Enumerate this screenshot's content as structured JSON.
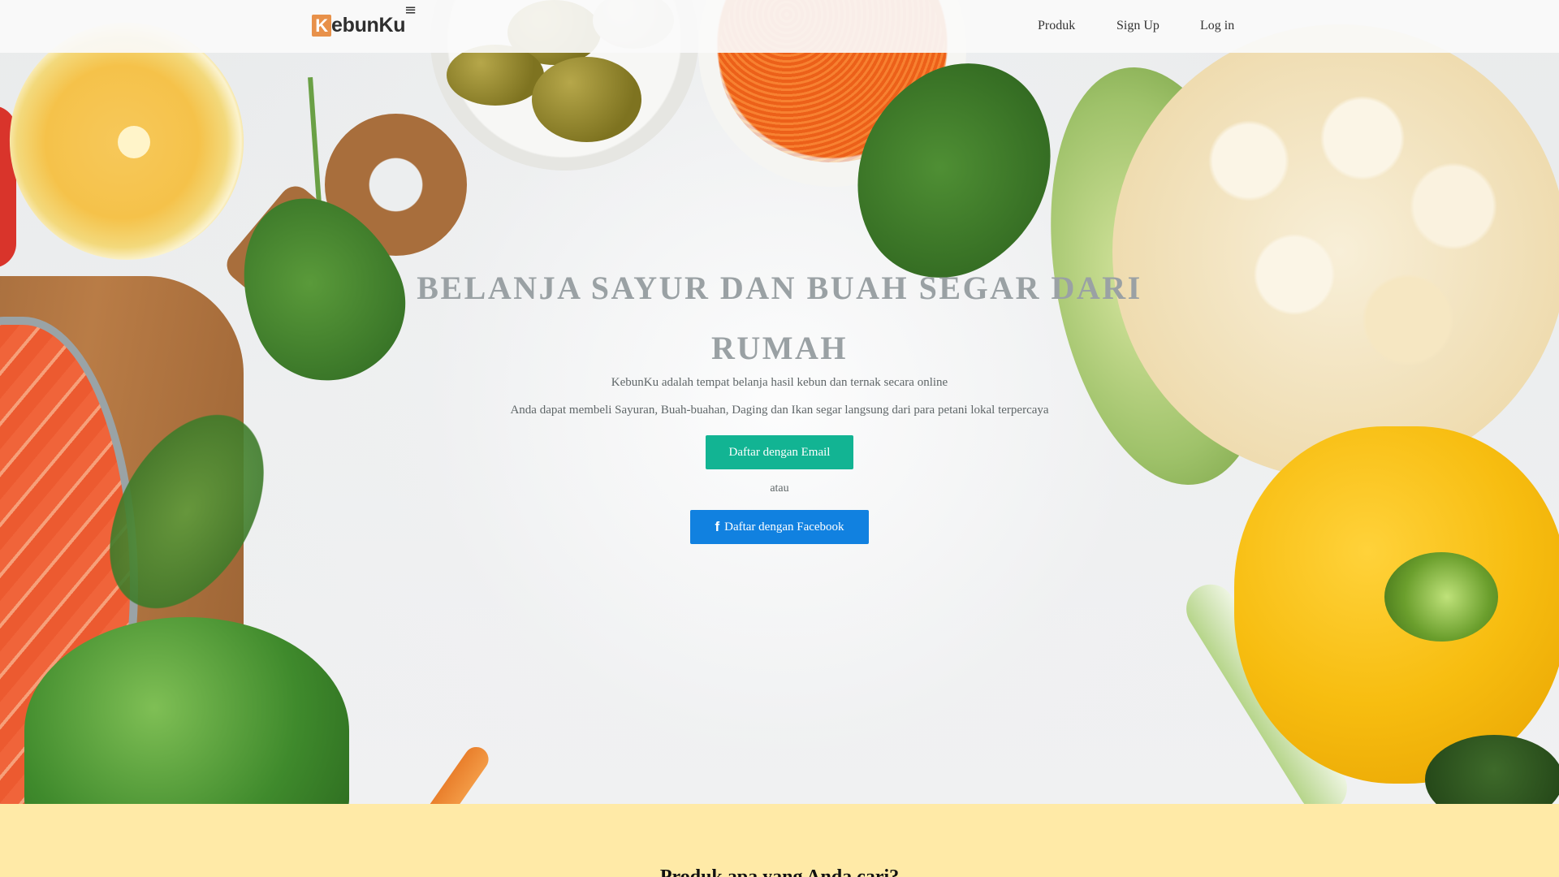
{
  "navbar": {
    "brand_initial": "K",
    "brand_rest": "ebunKu",
    "menu_icon": "hamburger-icon",
    "links": [
      "Produk",
      "Sign Up",
      "Log in"
    ]
  },
  "hero": {
    "title": "BELANJA SAYUR DAN BUAH SEGAR DARI RUMAH",
    "description_1": "KebunKu adalah tempat belanja hasil kebun dan ternak secara online",
    "description_2": "Anda dapat membeli Sayuran, Buah-buahan, Daging dan Ikan segar langsung dari para petani lokal terpercaya",
    "email_button": "Daftar dengan Email",
    "or_text": "atau",
    "facebook_icon": "facebook-icon",
    "facebook_button": "Daftar dengan Facebook"
  },
  "section": {
    "heading": "Produk apa yang Anda cari?"
  },
  "colors": {
    "brand_orange": "#e8914a",
    "email_button": "#12b493",
    "facebook_button": "#1181e0",
    "title_gray": "#9aa1a4",
    "section_bg": "#ffeaa7"
  }
}
